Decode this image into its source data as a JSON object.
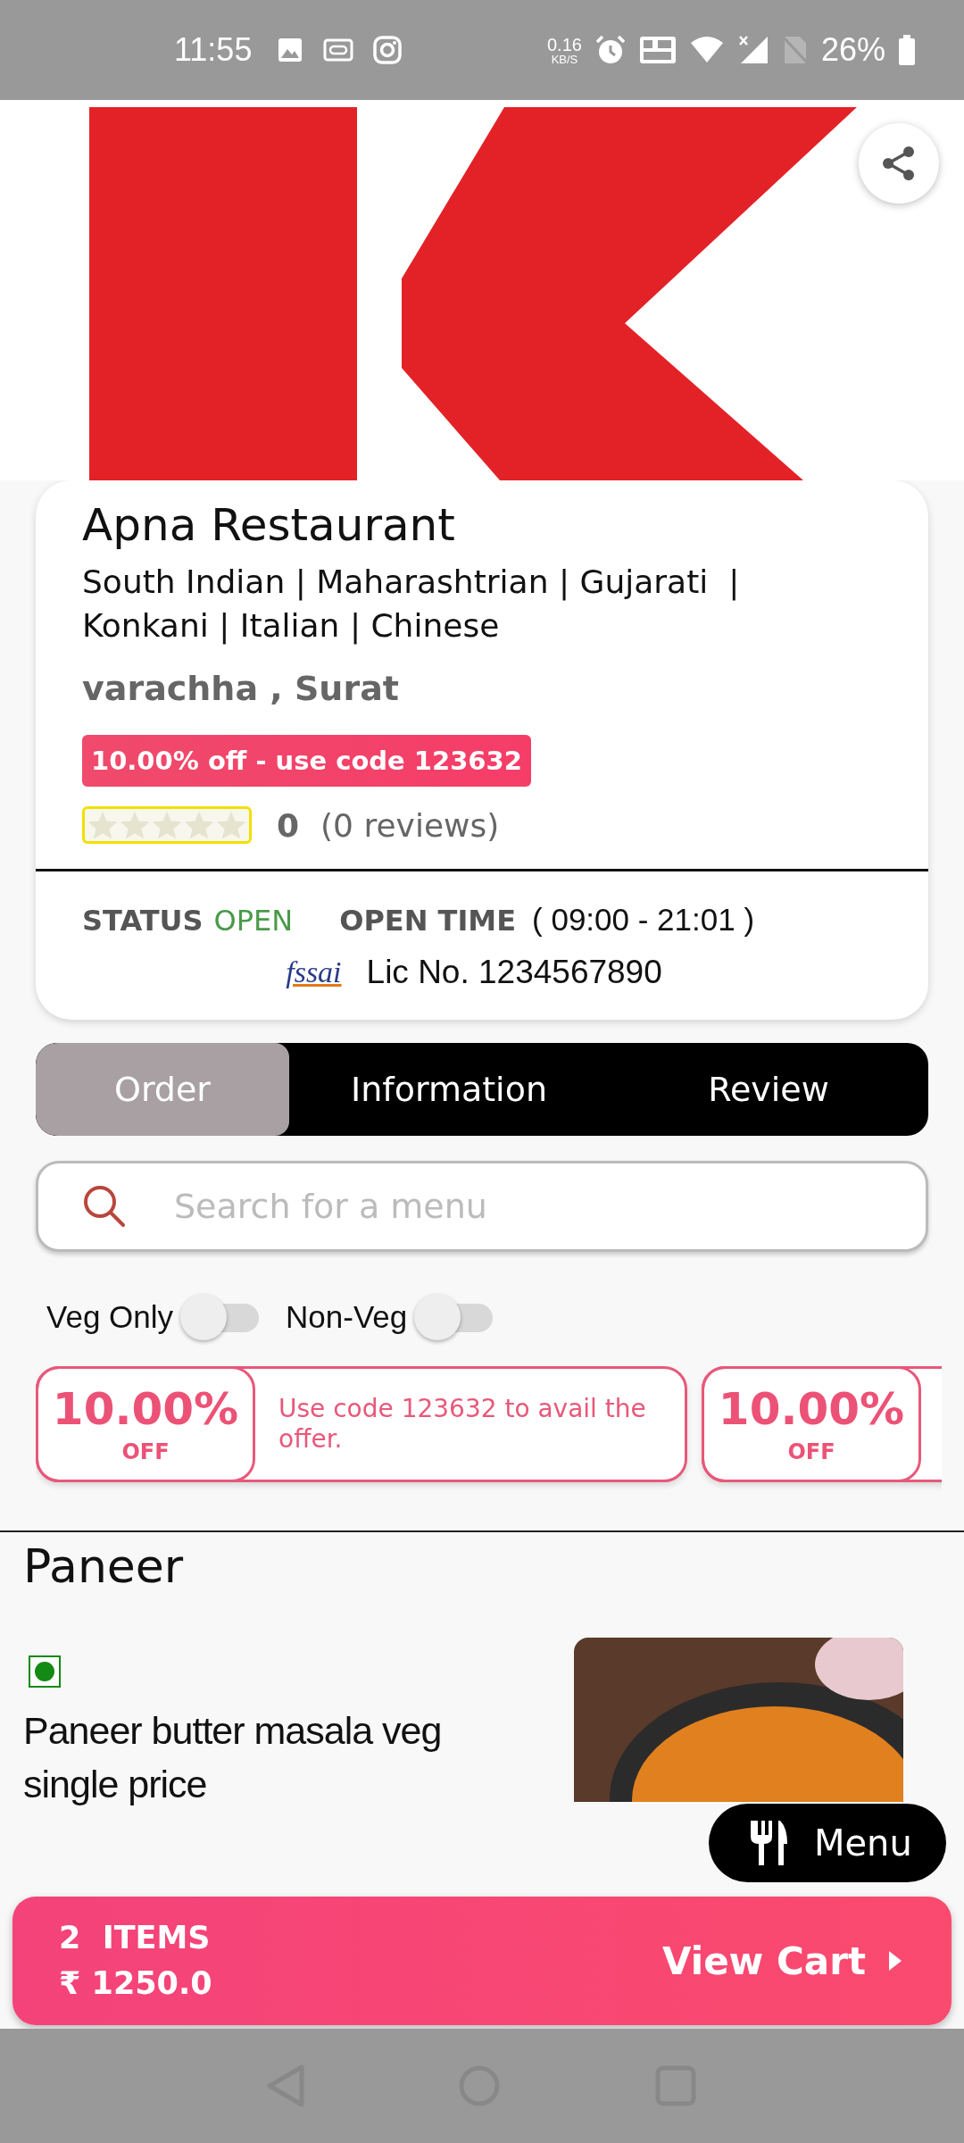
{
  "status_bar": {
    "time": "11:55",
    "speed_value": "0.16",
    "speed_unit": "KB/S",
    "battery": "26%"
  },
  "restaurant": {
    "name": "Apna Restaurant",
    "cuisines": "South Indian | Maharashtrian | Gujarati  | Konkani | Italian | Chinese",
    "location": "varachha , Surat",
    "offer_badge": "10.00% off - use code 123632",
    "stars": 0,
    "rating": "0",
    "reviews": "(0 reviews)",
    "status_label": "STATUS",
    "status_value": "OPEN",
    "open_time_label": "OPEN TIME",
    "open_time": "( 09:00 - 21:01 )",
    "fssai_logo": "fssai",
    "license": "Lic No. 1234567890"
  },
  "tabs": [
    {
      "label": "Order",
      "selected": true
    },
    {
      "label": "Information",
      "selected": false
    },
    {
      "label": "Review",
      "selected": false
    }
  ],
  "search": {
    "placeholder": "Search for a menu"
  },
  "filters": [
    {
      "label": "Veg Only",
      "on": false
    },
    {
      "label": "Non-Veg",
      "on": false
    }
  ],
  "offers": [
    {
      "percent": "10.00%",
      "off": "OFF",
      "text": "Use code 123632 to avail the offer."
    },
    {
      "percent": "10.00%",
      "off": "OFF"
    }
  ],
  "category": "Paneer",
  "items": [
    {
      "name": "Paneer butter masala veg single price",
      "veg": true
    }
  ],
  "menu_button": "Menu",
  "cart": {
    "count": "2  ITEMS",
    "total": "₹ 1250.0",
    "action": "View Cart"
  }
}
